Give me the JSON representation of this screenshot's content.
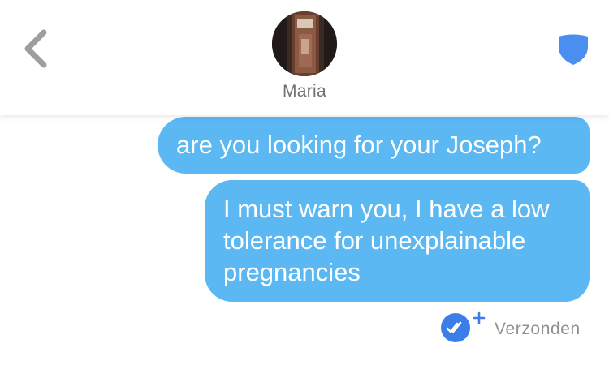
{
  "header": {
    "back_icon": "chevron-left-icon",
    "avatar_image": "profile photo",
    "contact_name": "Maria",
    "safety_icon": "shield-icon"
  },
  "messages": [
    {
      "text": "are you looking for your Joseph?",
      "direction": "sent"
    },
    {
      "text": "I must warn you, I have a low tolerance for unexplainable pregnancies",
      "direction": "sent"
    }
  ],
  "status": {
    "icon": "double-check-plus-icon",
    "label": "Verzonden"
  },
  "colors": {
    "bubble": "#5bb8f3",
    "shield": "#4a8ff0",
    "read_badge": "#3b7ee8",
    "chevron": "#9e9e9e"
  }
}
